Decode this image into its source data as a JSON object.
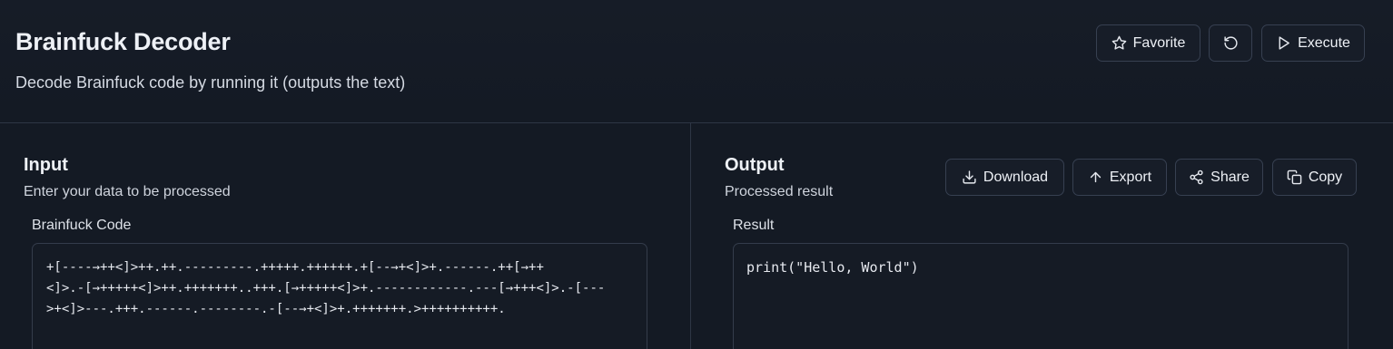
{
  "header": {
    "title": "Brainfuck Decoder",
    "subtitle": "Decode Brainfuck code by running it (outputs the text)",
    "favorite_label": "Favorite",
    "execute_label": "Execute"
  },
  "input_panel": {
    "title": "Input",
    "description": "Enter your data to be processed",
    "field_label": "Brainfuck Code",
    "code_lines": [
      "+[----→++<]>++.++.---------.+++++.++++++.+[--→+<]>+.------.++[→++",
      "<]>.-[→+++++<]>++.+++++++..+++.[→+++++<]>+.------------.---[→+++<]>.-[---",
      ">+<]>---.+++.------.--------.-[--→+<]>+.+++++++.>++++++++++."
    ]
  },
  "output_panel": {
    "title": "Output",
    "description": "Processed result",
    "field_label": "Result",
    "result_text": "print(\"Hello, World\")",
    "download_label": "Download",
    "export_label": "Export",
    "share_label": "Share",
    "copy_label": "Copy"
  },
  "icons": {
    "favorite": "star-icon",
    "reset": "rotate-ccw-icon",
    "execute": "play-icon",
    "download": "download-icon",
    "export": "arrow-up-icon",
    "share": "share-icon",
    "copy": "copy-icon"
  }
}
